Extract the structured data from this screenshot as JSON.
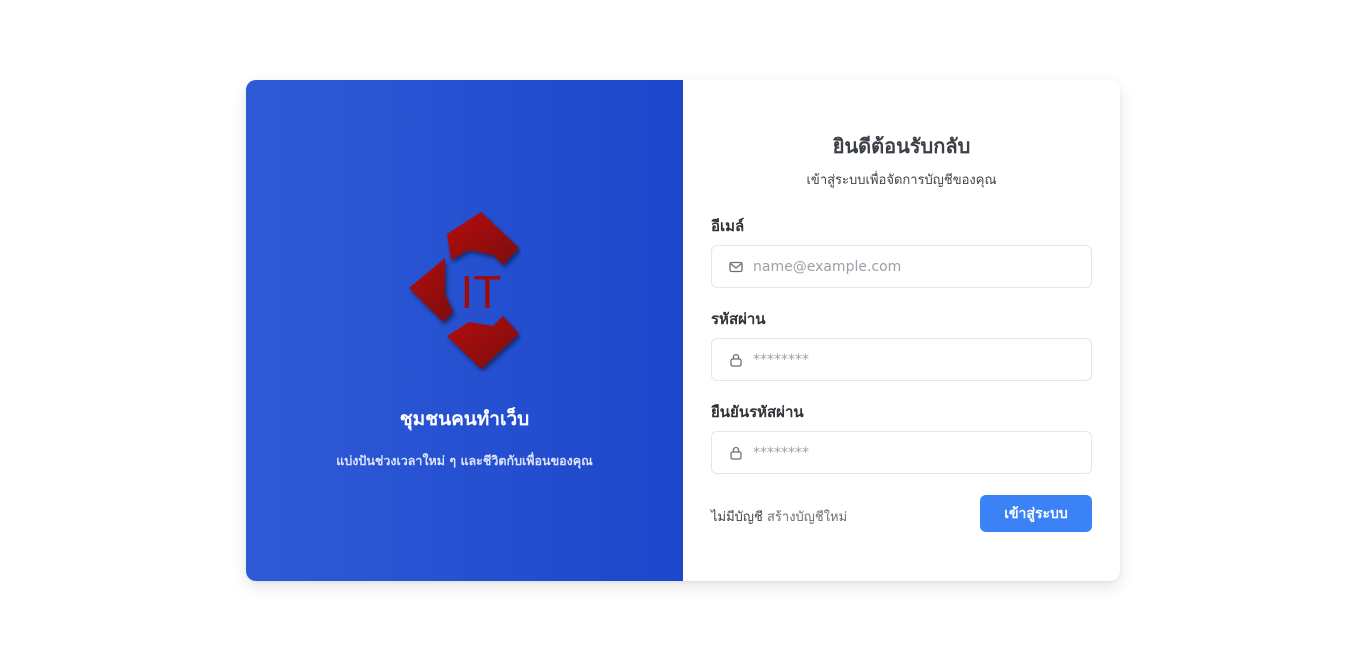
{
  "brand": {
    "logo_text": "IT",
    "title": "ชุมชนคนทำเว็บ",
    "subtitle": "แบ่งปันช่วงเวลาใหม่ ๆ และชีวิตกับเพื่อนของคุณ"
  },
  "form": {
    "heading": "ยินดีต้อนรับกลับ",
    "subheading": "เข้าสู่ระบบเพื่อจัดการบัญชีของคุณ",
    "email_label": "อีเมล์",
    "email_placeholder": "name@example.com",
    "password_label": "รหัสผ่าน",
    "password_placeholder": "********",
    "confirm_label": "ยืนยันรหัสผ่าน",
    "confirm_placeholder": "********",
    "no_account_text": "ไม่มีบัญชี",
    "signup_link": "สร้างบัญชีใหม่",
    "login_button": "เข้าสู่ระบบ"
  },
  "icons": {
    "email": "mail-icon",
    "password": "lock-icon",
    "confirm": "lock-icon"
  },
  "colors": {
    "panel_gradient_start": "#2f5ad6",
    "panel_gradient_end": "#1c47cb",
    "logo_red": "#a00a0a",
    "button_blue": "#3b82f6"
  }
}
